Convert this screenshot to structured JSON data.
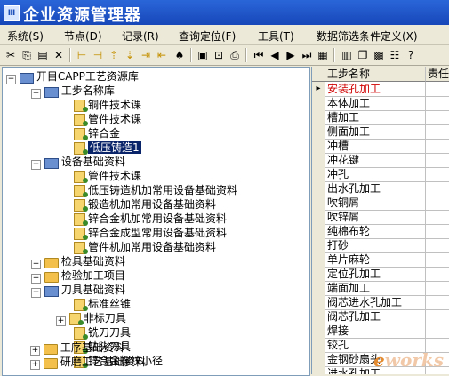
{
  "window": {
    "title": "企业资源管理器",
    "icon_text": "Ⅲ"
  },
  "menubar": [
    "系统(S)",
    "节点(D)",
    "记录(R)",
    "查询定位(F)",
    "工具(T)",
    "数据筛选条件定义(X)"
  ],
  "tree": {
    "root": "开目CAPP工艺资源库",
    "groups": [
      {
        "label": "工步名称库",
        "children": [
          "铜件技术课",
          "管件技术课",
          "锌合金",
          "低压铸造1"
        ],
        "selected": "低压铸造1"
      },
      {
        "label": "设备基础资料",
        "children": [
          "管件技术课",
          "低压铸造机加常用设备基础资料",
          "锻造机加常用设备基础资料",
          "锌合金机加常用设备基础资料",
          "锌合金成型常用设备基础资料",
          "管件机加常用设备基础资料"
        ]
      },
      {
        "label": "检具基础资料"
      },
      {
        "label": "检验加工项目"
      },
      {
        "label": "刀具基础资料",
        "children": [
          "标准丝锥",
          "非标刀具",
          "铣刀刀具",
          "钻头刀具",
          "锌合金螺纹小径"
        ]
      },
      {
        "label": "工序基础资料"
      },
      {
        "label": "研磨工艺基础资料"
      }
    ]
  },
  "grid": {
    "headers": [
      "工步名称",
      "责任人"
    ],
    "rows": [
      "安装孔加工",
      "本体加工",
      "槽加工",
      "侧面加工",
      "冲槽",
      "冲花键",
      "冲孔",
      "出水孔加工",
      "吹铜屑",
      "吹锌屑",
      "纯棉布轮",
      "打砂",
      "单片麻轮",
      "定位孔加工",
      "端面加工",
      "阀芯进水孔加工",
      "阀芯孔加工",
      "焊接",
      "铰孔",
      "金钢砂扇头",
      "进水孔加工"
    ]
  },
  "watermark": {
    "prefix": "e",
    "text": "works"
  }
}
